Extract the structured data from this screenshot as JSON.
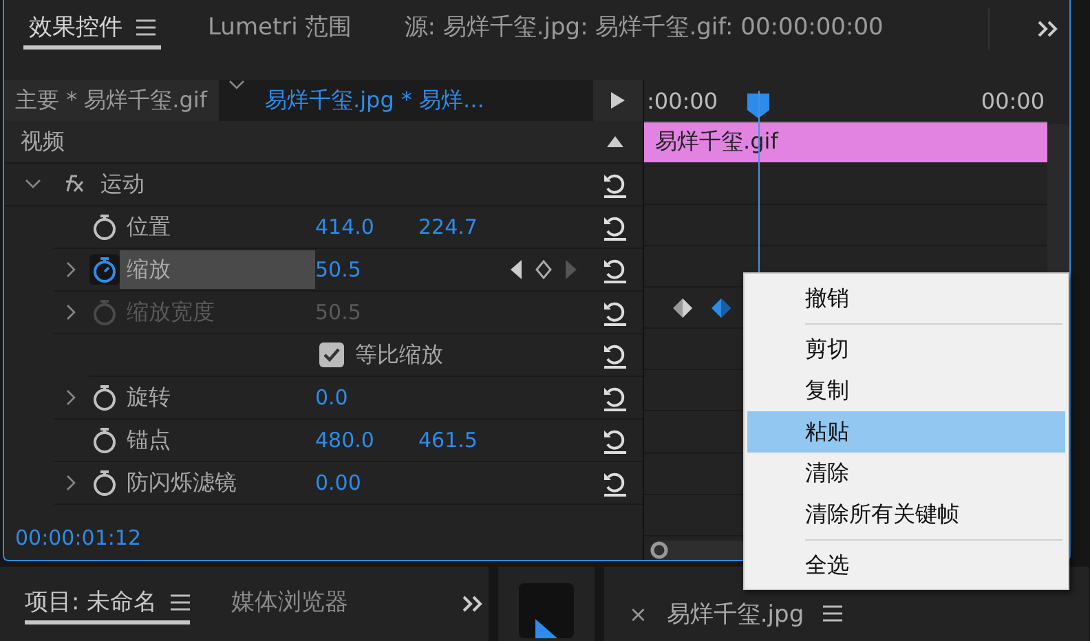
{
  "panel_tabs": [
    {
      "label": "效果控件",
      "selected": true,
      "has_menu": true
    },
    {
      "label": "Lumetri 范围",
      "selected": false,
      "has_menu": false
    },
    {
      "label": "源: 易烊千玺.jpg: 易烊千玺.gif: 00:00:00:00",
      "selected": false,
      "has_menu": false
    }
  ],
  "clip_tabs": [
    {
      "label": "主要 * 易烊千玺.gif",
      "selected": false
    },
    {
      "label": "易烊千玺.jpg * 易烊...",
      "selected": true
    }
  ],
  "section": {
    "label": "视频",
    "expanded": true
  },
  "effect": {
    "label": "运动",
    "expanded": true
  },
  "properties": [
    {
      "kind": "property",
      "label": "位置",
      "values": [
        "414.0",
        "224.7"
      ],
      "expandable": false,
      "animated": false,
      "disabled": false,
      "highlighted": false
    },
    {
      "kind": "property",
      "label": "缩放",
      "values": [
        "50.5"
      ],
      "expandable": true,
      "animated": true,
      "disabled": false,
      "highlighted": true,
      "keyframes": [
        {
          "selected": false
        },
        {
          "selected": true
        }
      ]
    },
    {
      "kind": "property",
      "label": "缩放宽度",
      "values": [
        "50.5"
      ],
      "expandable": true,
      "animated": false,
      "disabled": true,
      "highlighted": false
    },
    {
      "kind": "checkbox",
      "label": "等比缩放",
      "checked": true
    },
    {
      "kind": "property",
      "label": "旋转",
      "values": [
        "0.0"
      ],
      "expandable": true,
      "animated": false,
      "disabled": false,
      "highlighted": false
    },
    {
      "kind": "property",
      "label": "锚点",
      "values": [
        "480.0",
        "461.5"
      ],
      "expandable": false,
      "animated": false,
      "disabled": false,
      "highlighted": false
    },
    {
      "kind": "property",
      "label": "防闪烁滤镜",
      "values": [
        "0.00"
      ],
      "expandable": true,
      "animated": false,
      "disabled": false,
      "highlighted": false
    }
  ],
  "timecode": "00:00:01:12",
  "ruler": {
    "start": ":00:00",
    "end": "00:00"
  },
  "clip": {
    "label": "易烊千玺.gif"
  },
  "context_menu": {
    "groups": [
      [
        {
          "label": "撤销",
          "selected": false
        }
      ],
      [
        {
          "label": "剪切",
          "selected": false
        },
        {
          "label": "复制",
          "selected": false
        },
        {
          "label": "粘贴",
          "selected": true
        },
        {
          "label": "清除",
          "selected": false
        },
        {
          "label": "清除所有关键帧",
          "selected": false
        }
      ],
      [
        {
          "label": "全选",
          "selected": false
        }
      ]
    ]
  },
  "bottom": {
    "project_tabs": [
      {
        "label": "项目: 未命名",
        "selected": true,
        "has_menu": true
      },
      {
        "label": "媒体浏览器",
        "selected": false,
        "has_menu": false
      }
    ],
    "tool": {
      "selected": true
    },
    "sequence_tab": {
      "close": "×",
      "label": "易烊千玺.jpg"
    }
  }
}
